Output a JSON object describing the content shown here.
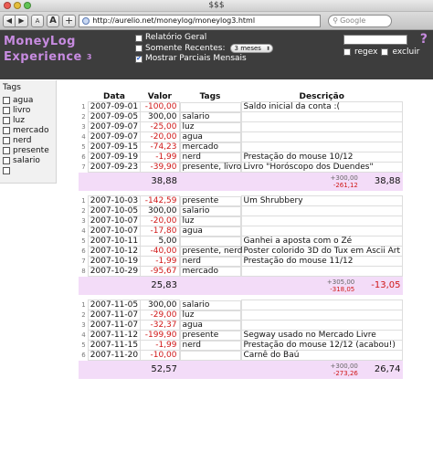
{
  "browser": {
    "window_title": "$$$",
    "url": "http://aurelio.net/moneylog/moneylog3.html",
    "search_placeholder": "Google",
    "font_small": "A",
    "font_large": "A",
    "add": "+"
  },
  "app": {
    "logo_line1": "MoneyLog",
    "logo_line2": "Experience",
    "logo_version": "3",
    "help": "?",
    "options": {
      "relatorio_geral": "Relatório Geral",
      "somente_recentes": "Somente Recentes:",
      "recentes_value": "3 meses",
      "mostrar_parciais": "Mostrar Parciais Mensais"
    },
    "filter": {
      "value": "",
      "regex": "regex",
      "excluir": "excluir"
    }
  },
  "sidebar": {
    "title": "Tags",
    "tags": [
      "agua",
      "livro",
      "luz",
      "mercado",
      "nerd",
      "presente",
      "salario",
      ""
    ]
  },
  "table": {
    "headers": [
      "Data",
      "Valor",
      "Tags",
      "Descrição"
    ],
    "months": [
      {
        "rows": [
          {
            "n": "1",
            "date": "2007-09-01",
            "value": "-100,00",
            "tags": "",
            "desc": "Saldo inicial da conta :("
          },
          {
            "n": "2",
            "date": "2007-09-05",
            "value": "300,00",
            "tags": "salario",
            "desc": ""
          },
          {
            "n": "3",
            "date": "2007-09-07",
            "value": "-25,00",
            "tags": "luz",
            "desc": ""
          },
          {
            "n": "4",
            "date": "2007-09-07",
            "value": "-20,00",
            "tags": "agua",
            "desc": ""
          },
          {
            "n": "5",
            "date": "2007-09-15",
            "value": "-74,23",
            "tags": "mercado",
            "desc": ""
          },
          {
            "n": "6",
            "date": "2007-09-19",
            "value": "-1,99",
            "tags": "nerd",
            "desc": "Prestação do mouse 10/12"
          },
          {
            "n": "7",
            "date": "2007-09-23",
            "value": "-39,90",
            "tags": "presente, livro",
            "desc": "Livro \"Horóscopo dos Duendes\""
          }
        ],
        "total": "38,88",
        "partial_pos": "+300,00",
        "partial_neg": "-261,12",
        "balance": "38,88"
      },
      {
        "rows": [
          {
            "n": "1",
            "date": "2007-10-03",
            "value": "-142,59",
            "tags": "presente",
            "desc": "Um Shrubbery"
          },
          {
            "n": "2",
            "date": "2007-10-05",
            "value": "300,00",
            "tags": "salario",
            "desc": ""
          },
          {
            "n": "3",
            "date": "2007-10-07",
            "value": "-20,00",
            "tags": "luz",
            "desc": ""
          },
          {
            "n": "4",
            "date": "2007-10-07",
            "value": "-17,80",
            "tags": "agua",
            "desc": ""
          },
          {
            "n": "5",
            "date": "2007-10-11",
            "value": "5,00",
            "tags": "",
            "desc": "Ganhei a aposta com o Zé"
          },
          {
            "n": "6",
            "date": "2007-10-12",
            "value": "-40,00",
            "tags": "presente, nerd",
            "desc": "Poster colorido 3D do Tux em Ascii Art"
          },
          {
            "n": "7",
            "date": "2007-10-19",
            "value": "-1,99",
            "tags": "nerd",
            "desc": "Prestação do mouse 11/12"
          },
          {
            "n": "8",
            "date": "2007-10-29",
            "value": "-95,67",
            "tags": "mercado",
            "desc": ""
          }
        ],
        "total": "25,83",
        "partial_pos": "+305,00",
        "partial_neg": "-318,05",
        "balance": "-13,05"
      },
      {
        "rows": [
          {
            "n": "1",
            "date": "2007-11-05",
            "value": "300,00",
            "tags": "salario",
            "desc": ""
          },
          {
            "n": "2",
            "date": "2007-11-07",
            "value": "-29,00",
            "tags": "luz",
            "desc": ""
          },
          {
            "n": "3",
            "date": "2007-11-07",
            "value": "-32,37",
            "tags": "agua",
            "desc": ""
          },
          {
            "n": "4",
            "date": "2007-11-12",
            "value": "-199,90",
            "tags": "presente",
            "desc": "Segway usado no Mercado Livre"
          },
          {
            "n": "5",
            "date": "2007-11-15",
            "value": "-1,99",
            "tags": "nerd",
            "desc": "Prestação do mouse 12/12 (acabou!)"
          },
          {
            "n": "6",
            "date": "2007-11-20",
            "value": "-10,00",
            "tags": "",
            "desc": "Carnê do Baú"
          }
        ],
        "total": "52,57",
        "partial_pos": "+300,00",
        "partial_neg": "-273,26",
        "balance": "26,74"
      }
    ]
  }
}
